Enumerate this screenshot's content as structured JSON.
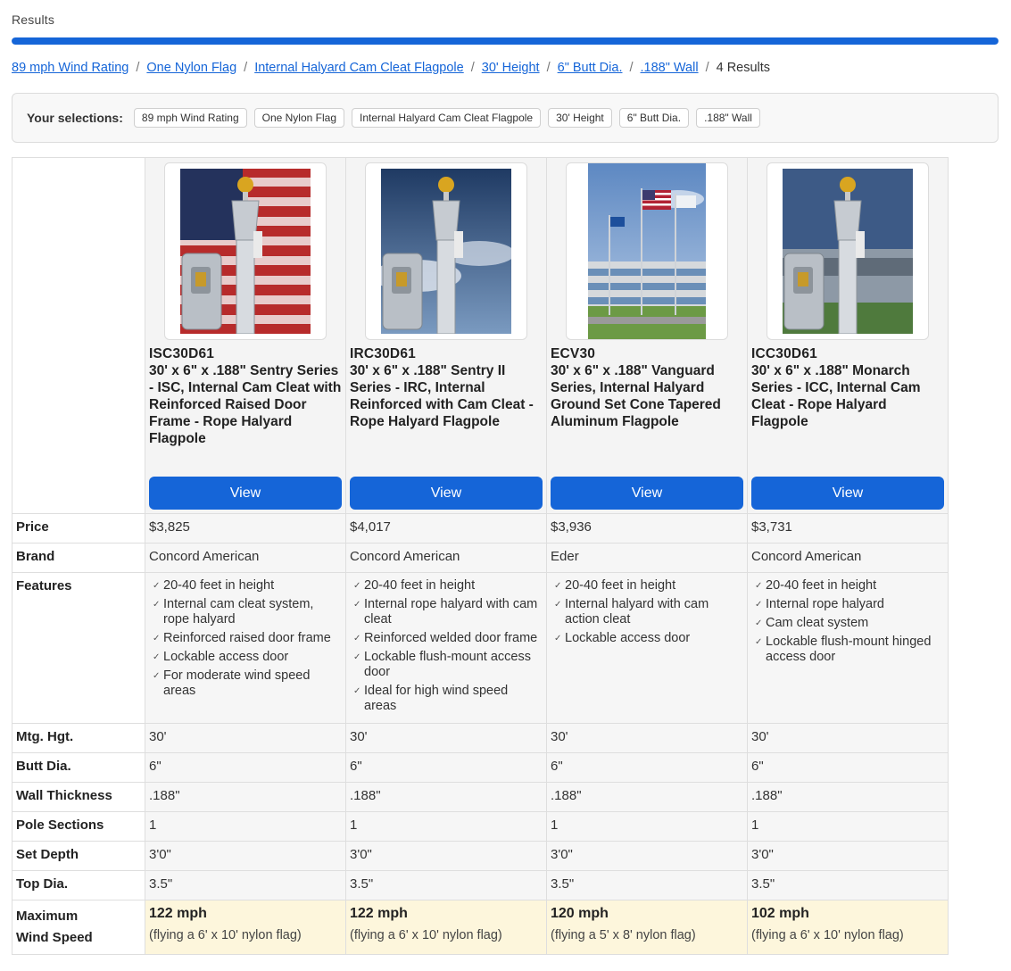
{
  "results_label": "Results",
  "progress_fraction": 1.0,
  "breadcrumb": {
    "links": [
      "89 mph Wind Rating",
      "One Nylon Flag",
      "Internal Halyard Cam Cleat Flagpole",
      "30' Height",
      "6\" Butt Dia.",
      ".188\" Wall"
    ],
    "separator": "/",
    "count": "4 Results"
  },
  "selections": {
    "label": "Your selections:",
    "chips": [
      "89 mph Wind Rating",
      "One Nylon Flag",
      "Internal Halyard Cam Cleat Flagpole",
      "30' Height",
      "6\" Butt Dia.",
      ".188\" Wall"
    ]
  },
  "colors": {
    "accent": "#1565d8",
    "max_wind_bg": "#fdf6dc",
    "product_bg": "#f4f4f4"
  },
  "row_labels": {
    "price": "Price",
    "brand": "Brand",
    "features": "Features",
    "mtg_hgt": "Mtg. Hgt.",
    "butt_dia": "Butt Dia.",
    "wall": "Wall Thickness",
    "sections": "Pole Sections",
    "set_depth": "Set Depth",
    "top_dia": "Top Dia.",
    "max_wind": "Maximum\nWind Speed"
  },
  "products": [
    {
      "sku": "ISC30D61",
      "name": "30' x 6\" x .188\" Sentry Series - ISC, Internal Cam Cleat with Reinforced Raised Door Frame - Rope Halyard Flagpole",
      "view_label": "View",
      "image": "flagpole-cam-cleat-flag-background",
      "price": "$3,825",
      "brand": "Concord American",
      "features": [
        "20-40 feet in height",
        "Internal cam cleat system, rope halyard",
        "Reinforced raised door frame",
        "Lockable access door",
        "For moderate wind speed areas"
      ],
      "mtg_hgt": "30'",
      "butt_dia": "6\"",
      "wall": ".188\"",
      "sections": "1",
      "set_depth": "3'0\"",
      "top_dia": "3.5\"",
      "max_wind": "122 mph",
      "flying": "(flying a 6' x 10' nylon flag)"
    },
    {
      "sku": "IRC30D61",
      "name": "30' x 6\" x .188\" Sentry II Series - IRC, Internal Reinforced with Cam Cleat - Rope Halyard Flagpole",
      "view_label": "View",
      "image": "flagpole-cam-cleat-sky-background",
      "price": "$4,017",
      "brand": "Concord American",
      "features": [
        "20-40 feet in height",
        "Internal rope halyard with cam cleat",
        "Reinforced welded door frame",
        "Lockable flush-mount access door",
        "Ideal for high wind speed areas"
      ],
      "mtg_hgt": "30'",
      "butt_dia": "6\"",
      "wall": ".188\"",
      "sections": "1",
      "set_depth": "3'0\"",
      "top_dia": "3.5\"",
      "max_wind": "122 mph",
      "flying": "(flying a 6' x 10' nylon flag)"
    },
    {
      "sku": "ECV30",
      "name": "30' x 6\" x .188\" Vanguard Series, Internal Halyard Ground Set Cone Tapered Aluminum Flagpole",
      "view_label": "View",
      "image": "flagpoles-in-front-of-building",
      "price": "$3,936",
      "brand": "Eder",
      "features": [
        "20-40 feet in height",
        "Internal halyard with cam action cleat",
        "Lockable access door"
      ],
      "mtg_hgt": "30'",
      "butt_dia": "6\"",
      "wall": ".188\"",
      "sections": "1",
      "set_depth": "3'0\"",
      "top_dia": "3.5\"",
      "max_wind": "120 mph",
      "flying": "(flying a 5' x 8' nylon flag)"
    },
    {
      "sku": "ICC30D61",
      "name": "30' x 6\" x .188\" Monarch Series - ICC, Internal Cam Cleat - Rope Halyard Flagpole",
      "view_label": "View",
      "image": "flagpole-cam-cleat-building-background",
      "price": "$3,731",
      "brand": "Concord American",
      "features": [
        "20-40 feet in height",
        "Internal rope halyard",
        "Cam cleat system",
        "Lockable flush-mount hinged access door"
      ],
      "mtg_hgt": "30'",
      "butt_dia": "6\"",
      "wall": ".188\"",
      "sections": "1",
      "set_depth": "3'0\"",
      "top_dia": "3.5\"",
      "max_wind": "102 mph",
      "flying": "(flying a 6' x 10' nylon flag)"
    }
  ]
}
